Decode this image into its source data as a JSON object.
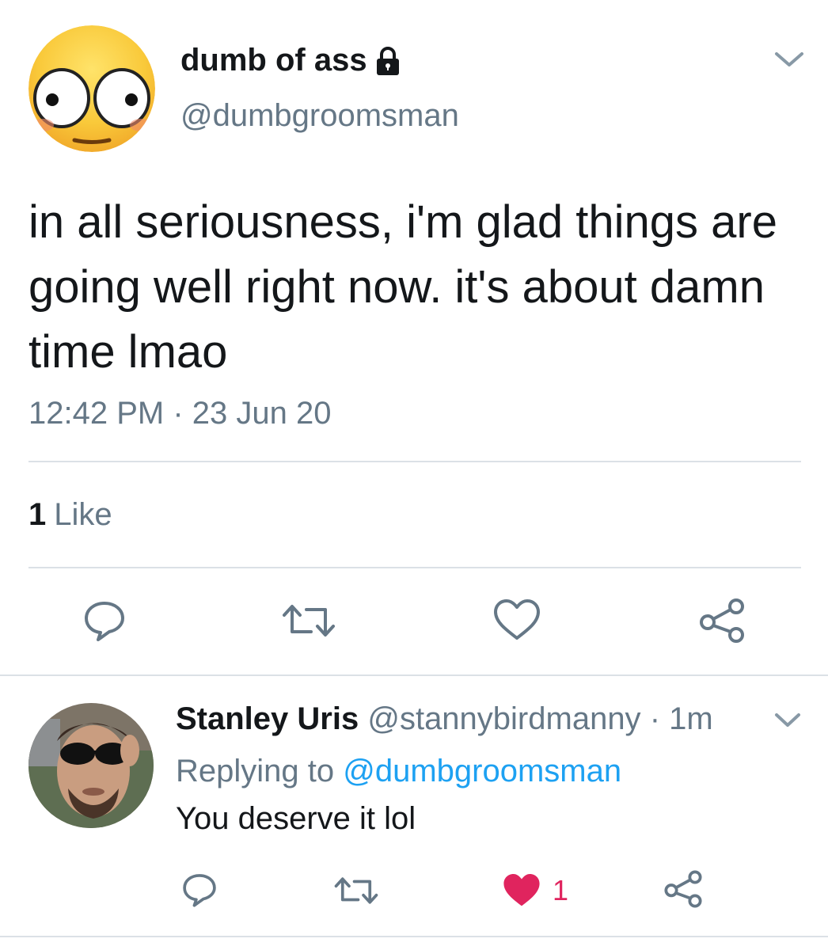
{
  "tweet": {
    "display_name": "dumb of ass",
    "handle": "@dumbgroomsman",
    "text": "in all seriousness, i'm glad things are going well right now. it's about damn time lmao",
    "timestamp": "12:42 PM · 23 Jun 20",
    "likes_count": "1",
    "likes_label": "Like"
  },
  "reply": {
    "display_name": "Stanley Uris",
    "handle": "@stannybirdmanny",
    "separator": "·",
    "time": "1m",
    "replying_prefix": "Replying to",
    "replying_mention": "@dumbgroomsman",
    "text": "You deserve it lol",
    "like_count": "1"
  },
  "icons": {
    "lock": "lock-icon",
    "chevron": "chevron-down-icon",
    "reply": "reply-icon",
    "retweet": "retweet-icon",
    "like": "heart-icon",
    "share": "share-icon"
  },
  "colors": {
    "text": "#14171a",
    "secondary": "#657786",
    "link": "#1da1f2",
    "like": "#e0245e",
    "divider": "#dbe1e6"
  }
}
